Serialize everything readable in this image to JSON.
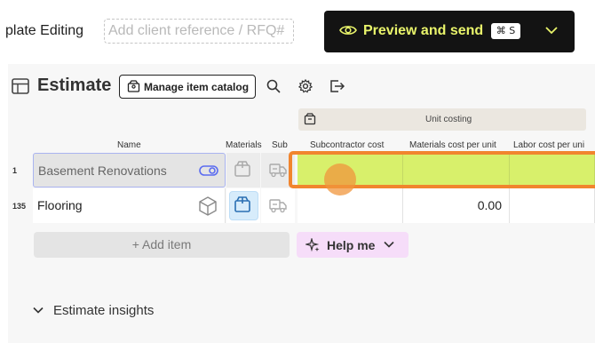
{
  "header": {
    "title": "plate Editing",
    "client_ref_placeholder": "Add client reference / RFQ#",
    "preview_label": "Preview and send",
    "shortcut": "⌘ S",
    "accent": "#e9f46b"
  },
  "toolbar": {
    "title": "Estimate",
    "catalog_label": "Manage item catalog",
    "icons": [
      "table-icon",
      "box-icon",
      "search-icon",
      "gear-icon",
      "export-icon"
    ]
  },
  "table": {
    "group_header": "Unit costing",
    "columns": {
      "name": "Name",
      "materials": "Materials",
      "sub": "Sub",
      "subcontractor_cost": "Subcontractor cost",
      "materials_cost": "Materials cost per unit",
      "labor_cost": "Labor cost per uni"
    },
    "rows": [
      {
        "num": "1",
        "name": "Basement Renovations",
        "subcontractor_cost": "",
        "materials_cost": "",
        "labor_cost": ""
      },
      {
        "num": "135",
        "name": "Flooring",
        "subcontractor_cost": "",
        "materials_cost": "0.00",
        "labor_cost": ""
      }
    ],
    "selected_row_color": "#d8f06b",
    "highlight_color": "#f1852e"
  },
  "actions": {
    "add_item": "+ Add item",
    "help_me": "Help me"
  },
  "insights": {
    "label": "Estimate insights"
  }
}
